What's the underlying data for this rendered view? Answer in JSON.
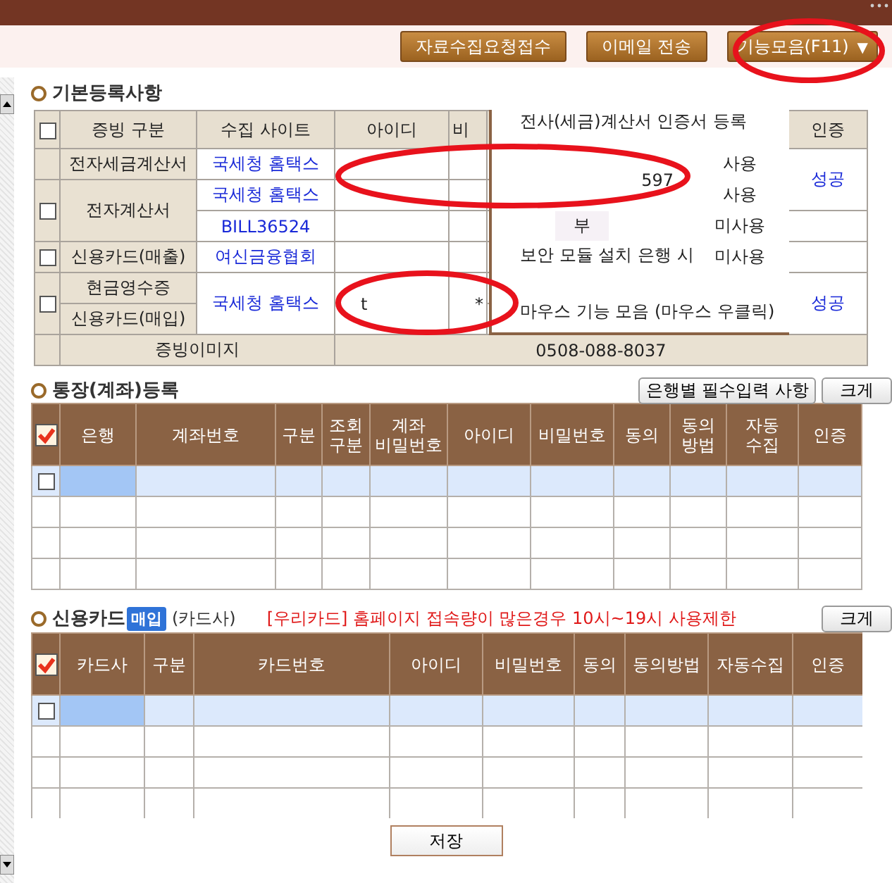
{
  "toolbar": {
    "buttons": [
      {
        "label": "자료수집요청접수"
      },
      {
        "label": "이메일 전송"
      },
      {
        "label": "기능모음(F11)",
        "caret": "▼"
      }
    ]
  },
  "basic": {
    "title": "기본등록사항",
    "header_checkbox": {
      "checked": false
    },
    "columns": [
      "증빙 구분",
      "수집 사이트",
      "아이디",
      "비",
      "인증"
    ],
    "rows": [
      {
        "type": "전자세금계산서",
        "site": "국세청 홈택스",
        "usage": "사용",
        "auth": "성공",
        "masked": "597"
      },
      {
        "checked": false,
        "type": "전자계산서",
        "site": "국세청 홈택스",
        "usage": "사용"
      },
      {
        "site": "BILL36524",
        "consent": "부",
        "usage": "미사용"
      },
      {
        "checked": false,
        "type": "신용카드(매출)",
        "site": "여신금융협회",
        "usage": "미사용"
      },
      {
        "checked": false,
        "type": "현금영수증",
        "site": "국세청 홈택스",
        "user_id": "t",
        "password": "*",
        "auth": "성공"
      },
      {
        "type": "신용카드(매입)"
      }
    ],
    "image_row": {
      "label": "증빙이미지",
      "phone": "0508-088-8037"
    }
  },
  "context_menu": {
    "items": [
      "전사(세금)계산서 인증서 등록",
      "보안 모듈 설치 은행 시",
      "마우스 기능 모음 (마우스 우클릭)"
    ]
  },
  "accounts": {
    "title": "통장(계좌)등록",
    "buttons": [
      "은행별 필수입력 사항",
      "크게"
    ],
    "header_checkbox": {
      "checked": true
    },
    "columns": [
      "은행",
      "계좌번호",
      "구분",
      "조회\n구분",
      "계좌\n비밀번호",
      "아이디",
      "비밀번호",
      "동의",
      "동의\n방법",
      "자동\n수집",
      "인증"
    ],
    "rows": [
      {
        "selected": true,
        "checked": false
      },
      {
        "selected": false
      },
      {
        "selected": false
      },
      {
        "selected": false
      }
    ]
  },
  "cards": {
    "title": "신용카드",
    "badge": "매입",
    "subtitle": "(카드사)",
    "notice": "[우리카드] 홈페이지 접속량이 많은경우 10시~19시 사용제한",
    "buttons": [
      "크게"
    ],
    "header_checkbox": {
      "checked": true
    },
    "columns": [
      "카드사",
      "구분",
      "카드번호",
      "아이디",
      "비밀번호",
      "동의",
      "동의방법",
      "자동수집",
      "인증"
    ],
    "rows": [
      {
        "selected": true,
        "checked": false
      },
      {
        "selected": false
      },
      {
        "selected": false
      },
      {
        "selected": false
      }
    ]
  },
  "save_button": "저장"
}
